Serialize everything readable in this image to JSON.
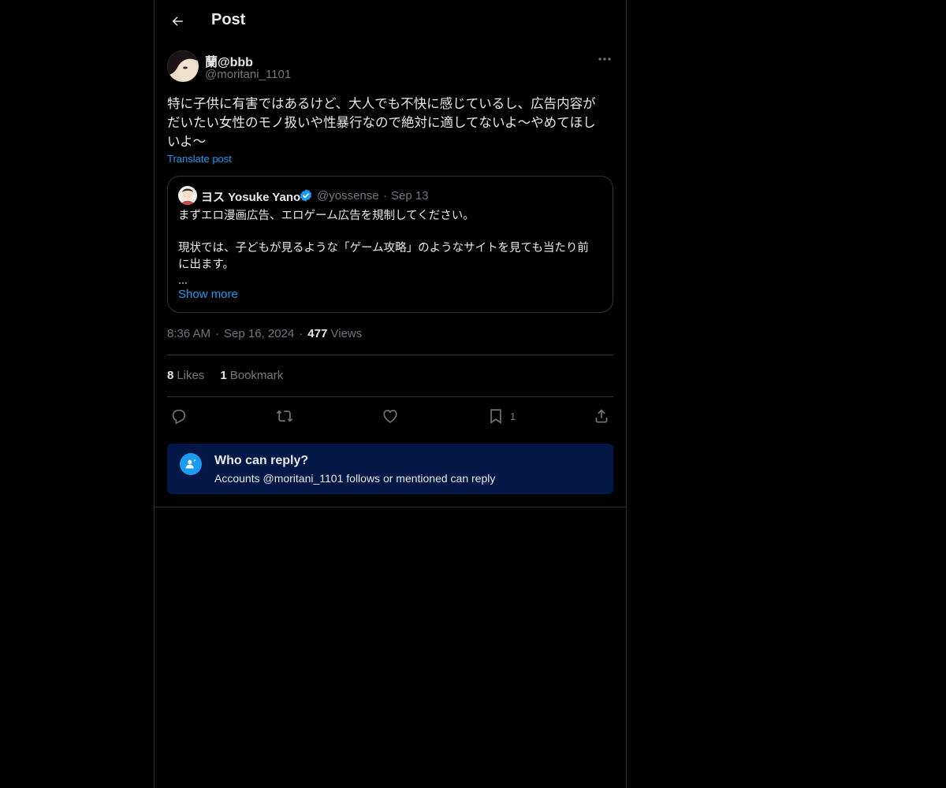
{
  "header": {
    "title": "Post"
  },
  "post": {
    "author_name": "蘭@bbb",
    "author_handle": "@moritani_1101",
    "text": "特に子供に有害ではあるけど、大人でも不快に感じているし、広告内容が\nだいたい女性のモノ扱いや性暴行なので絶対に適してないよ〜やめてほし\nいよ〜",
    "translate_label": "Translate post",
    "time": "8:36 AM",
    "date": "Sep 16, 2024",
    "views_count": "477",
    "views_label": "Views",
    "likes_count": "8",
    "likes_label": "Likes",
    "bookmarks_count": "1",
    "bookmarks_label": "Bookmark",
    "bookmark_action_count": "1"
  },
  "quote": {
    "author_name": "ヨス Yosuke Yano",
    "author_handle": "@yossense",
    "date": "Sep 13",
    "text": "まずエロ漫画広告、エロゲーム広告を規制してください。\n\n現状では、子どもが見るような「ゲーム攻略」のようなサイトを見ても当たり前\nに出ます。\n...",
    "show_more": "Show more"
  },
  "reply_restriction": {
    "title": "Who can reply?",
    "subtitle": "Accounts @moritani_1101 follows or mentioned can reply"
  },
  "icons": {
    "back": "arrow-left-icon",
    "more": "more-horizontal-icon",
    "verified": "verified-badge-icon",
    "reply": "reply-icon",
    "repost": "repost-icon",
    "like": "heart-icon",
    "bookmark": "bookmark-icon",
    "share": "share-icon",
    "who_can_reply": "person-mention-icon"
  },
  "colors": {
    "background": "#000000",
    "accent": "#1d9bf0",
    "muted_text": "#71767b",
    "divider": "#2f3336",
    "reply_box_bg": "#031846"
  }
}
